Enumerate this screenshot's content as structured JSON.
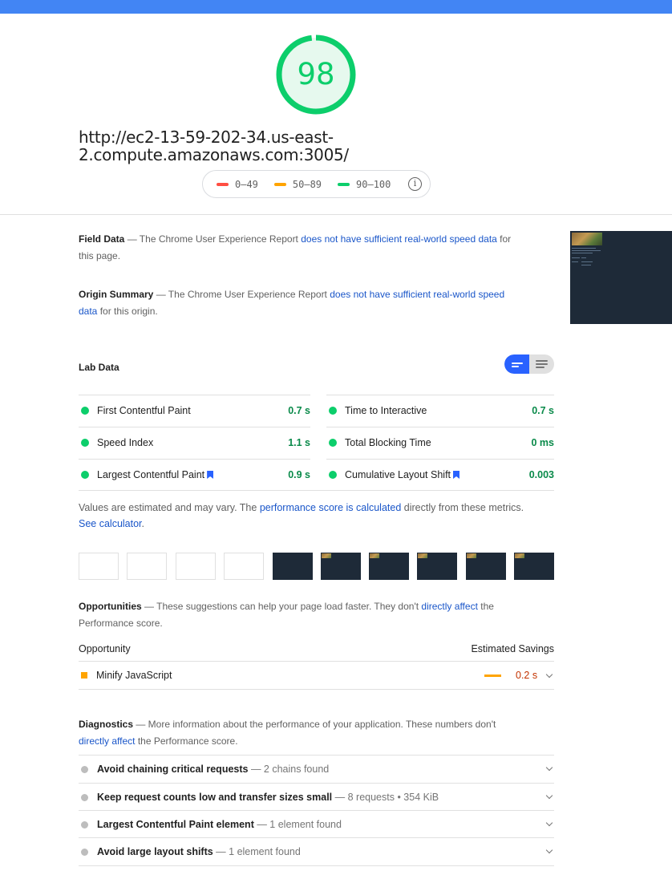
{
  "score": {
    "value": "98",
    "color": "#0cce6b"
  },
  "url": "http://ec2-13-59-202-34.us-east-2.compute.amazonaws.com:3005/",
  "legend": [
    {
      "label": "0–49",
      "color": "#ff4e42"
    },
    {
      "label": "50–89",
      "color": "#ffa400"
    },
    {
      "label": "90–100",
      "color": "#0cce6b"
    }
  ],
  "field_data": {
    "title": "Field Data",
    "prefix": " — The Chrome User Experience Report ",
    "link": "does not have sufficient real-world speed data",
    "suffix": " for this page."
  },
  "origin_summary": {
    "title": "Origin Summary",
    "prefix": " — The Chrome User Experience Report ",
    "link": "does not have sufficient real-world speed data",
    "suffix": " for this origin."
  },
  "lab_data": {
    "title": "Lab Data",
    "metrics": [
      {
        "name": "First Contentful Paint",
        "value": "0.7 s"
      },
      {
        "name": "Time to Interactive",
        "value": "0.7 s"
      },
      {
        "name": "Speed Index",
        "value": "1.1 s"
      },
      {
        "name": "Total Blocking Time",
        "value": "0 ms"
      },
      {
        "name": "Largest Contentful Paint",
        "value": "0.9 s"
      },
      {
        "name": "Cumulative Layout Shift",
        "value": "0.003"
      }
    ]
  },
  "note": {
    "prefix": "Values are estimated and may vary. The ",
    "link1": "performance score is calculated",
    "middle": " directly from these metrics. ",
    "link2": "See calculator",
    "suffix": "."
  },
  "opportunities": {
    "title": "Opportunities",
    "desc_prefix": " — These suggestions can help your page load faster. They don't ",
    "desc_link": "directly affect",
    "desc_suffix": " the Performance score.",
    "col_left": "Opportunity",
    "col_right": "Estimated Savings",
    "items": [
      {
        "name": "Minify JavaScript",
        "savings": "0.2 s"
      }
    ]
  },
  "diagnostics": {
    "title": "Diagnostics",
    "desc_prefix": " — More information about the performance of your application. These numbers don't ",
    "desc_link": "directly affect",
    "desc_suffix": " the Performance score.",
    "items": [
      {
        "name": "Avoid chaining critical requests",
        "detail": " — 2 chains found"
      },
      {
        "name": "Keep request counts low and transfer sizes small",
        "detail": " — 8 requests • 354 KiB"
      },
      {
        "name": "Largest Contentful Paint element",
        "detail": " — 1 element found"
      },
      {
        "name": "Avoid large layout shifts",
        "detail": " — 1 element found"
      }
    ]
  }
}
